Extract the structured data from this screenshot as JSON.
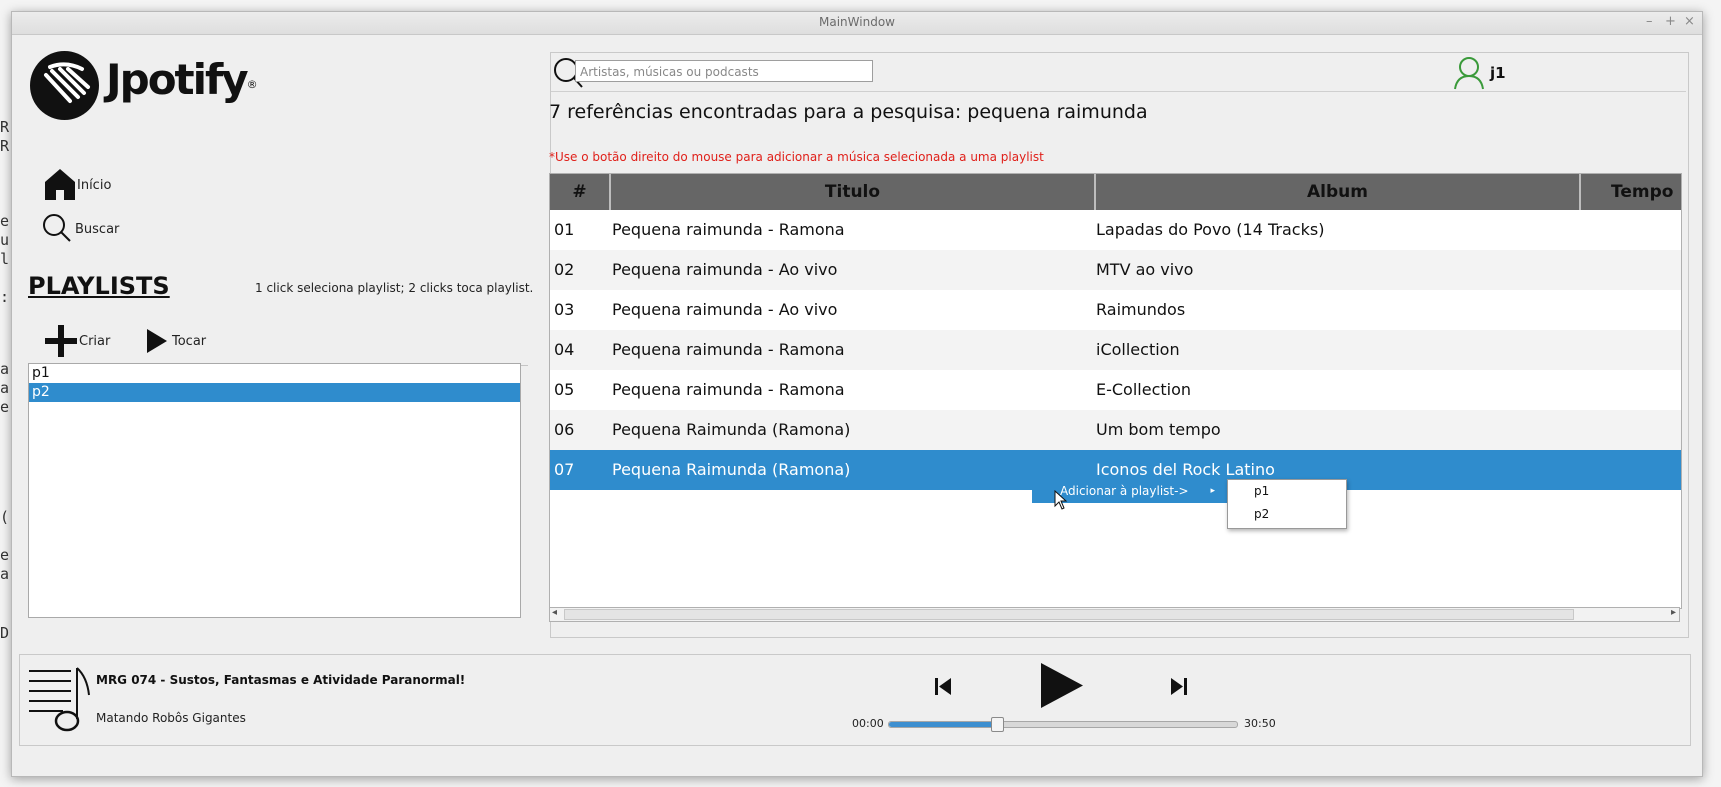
{
  "window": {
    "title": "MainWindow",
    "controls": [
      "–",
      "+",
      "×"
    ]
  },
  "background_text": [
    "R",
    "R",
    "e",
    "u",
    "l",
    ":",
    "a",
    "a",
    "e",
    "(",
    "e",
    "a",
    "D"
  ],
  "sidebar": {
    "logo_text": "Jpotify",
    "logo_mark": "®",
    "nav": [
      {
        "label": "Início",
        "icon": "home-icon"
      },
      {
        "label": "Buscar",
        "icon": "search-icon"
      }
    ],
    "playlists_title": "PLAYLISTS",
    "playlists_hint": "1 click seleciona playlist; 2 clicks toca playlist.",
    "create_label": "Criar",
    "play_label": "Tocar",
    "playlists": [
      {
        "name": "p1",
        "selected": false
      },
      {
        "name": "p2",
        "selected": true
      }
    ]
  },
  "search": {
    "placeholder": "Artistas, músicas ou podcasts",
    "value": ""
  },
  "user": {
    "name": "j1",
    "icon": "user-icon",
    "icon_color": "#3a9a3a"
  },
  "results": {
    "title": "7 referências encontradas para a pesquisa: pequena raimunda",
    "note": "*Use o botão direito do mouse para adicionar a música selecionada a uma playlist",
    "note_color": "#e0201a"
  },
  "table": {
    "columns": [
      "#",
      "Titulo",
      "Album",
      "Tempo"
    ],
    "rows": [
      {
        "num": "01",
        "title": "Pequena raimunda - Ramona",
        "album": "Lapadas do Povo (14 Tracks)"
      },
      {
        "num": "02",
        "title": "Pequena raimunda - Ao vivo",
        "album": "MTV ao vivo"
      },
      {
        "num": "03",
        "title": "Pequena raimunda - Ao vivo",
        "album": "Raimundos"
      },
      {
        "num": "04",
        "title": "Pequena raimunda - Ramona",
        "album": "iCollection"
      },
      {
        "num": "05",
        "title": "Pequena raimunda - Ramona",
        "album": "E-Collection"
      },
      {
        "num": "06",
        "title": "Pequena Raimunda (Ramona)",
        "album": "Um bom tempo"
      },
      {
        "num": "07",
        "title": "Pequena Raimunda (Ramona)",
        "album": "Iconos del Rock Latino"
      }
    ],
    "selected_index": 6,
    "selection_color": "#2f8ccd"
  },
  "context_menu": {
    "label": "Adicionar à playlist->",
    "submenu": [
      "p1",
      "p2"
    ]
  },
  "player": {
    "track_title": "MRG 074 - Sustos, Fantasmas e Atividade Paranormal!",
    "track_artist": "Matando Robôs Gigantes",
    "time_elapsed": "00:00",
    "time_total": "30:50",
    "progress": 0.31,
    "icons": [
      "music-note-icon",
      "previous-icon",
      "play-icon",
      "next-icon"
    ]
  }
}
